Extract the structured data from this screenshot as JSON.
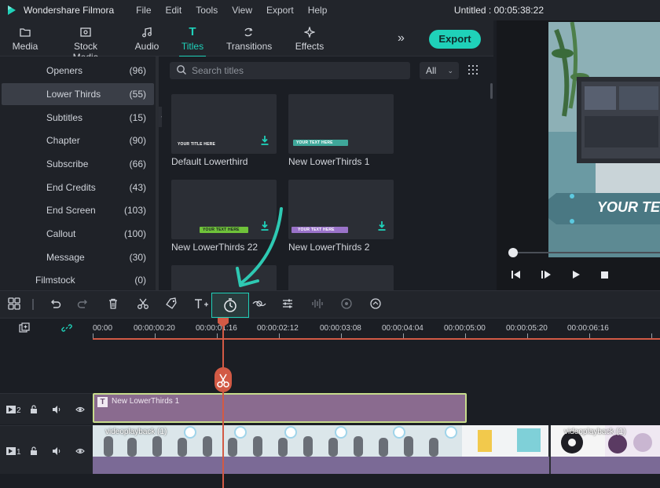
{
  "app": {
    "title": "Wondershare Filmora",
    "project_title": "Untitled : 00:05:38:22"
  },
  "menu": [
    "File",
    "Edit",
    "Tools",
    "View",
    "Export",
    "Help"
  ],
  "tabs": [
    {
      "label": "Media",
      "icon": "folder-icon"
    },
    {
      "label": "Stock Media",
      "icon": "stock-media-icon"
    },
    {
      "label": "Audio",
      "icon": "music-note-icon"
    },
    {
      "label": "Titles",
      "icon": "text-t-icon",
      "active": true
    },
    {
      "label": "Transitions",
      "icon": "transitions-icon"
    },
    {
      "label": "Effects",
      "icon": "effects-sparkle-icon"
    }
  ],
  "toolbar_top": {
    "more_label": "»",
    "export_label": "Export"
  },
  "categories": [
    {
      "name": "Openers",
      "count": "(96)"
    },
    {
      "name": "Lower Thirds",
      "count": "(55)",
      "selected": true
    },
    {
      "name": "Subtitles",
      "count": "(15)"
    },
    {
      "name": "Chapter",
      "count": "(90)"
    },
    {
      "name": "Subscribe",
      "count": "(66)"
    },
    {
      "name": "End Credits",
      "count": "(43)"
    },
    {
      "name": "End Screen",
      "count": "(103)"
    },
    {
      "name": "Callout",
      "count": "(100)"
    },
    {
      "name": "Message",
      "count": "(30)"
    },
    {
      "name": "Filmstock",
      "count": "(0)"
    }
  ],
  "search": {
    "placeholder": "Search titles"
  },
  "filter": {
    "value": "All"
  },
  "cards": [
    {
      "caption": "Default Lowerthird",
      "thumb_text": "YOUR TITLE HERE",
      "bar_color": ""
    },
    {
      "caption": "New LowerThirds 1",
      "thumb_text": "YOUR TEXT HERE",
      "bar_color": "#3fa79a"
    },
    {
      "caption": "New LowerThirds 22",
      "thumb_text": "YOUR TEXT HERE",
      "bar_color": "#6fc23a"
    },
    {
      "caption": "New LowerThirds 2",
      "thumb_text": "YOUR TEXT HERE",
      "bar_color": "#9a73c9"
    }
  ],
  "preview": {
    "overlay_text": "YOUR TE"
  },
  "timeline": {
    "ruler_labels": [
      "00:00",
      "00:00:00:20",
      "00:00:01:16",
      "00:00:02:12",
      "00:00:03:08",
      "00:00:04:04",
      "00:00:05:00",
      "00:00:05:20",
      "00:00:06:16"
    ],
    "tracks": [
      {
        "number": "2"
      },
      {
        "number": "1"
      }
    ],
    "title_clip": "New LowerThirds 1",
    "video_clip_1": "videoplayback (1)",
    "video_clip_2": "videoplayback (1)"
  },
  "colors": {
    "accent": "#1fd1b9",
    "playhead": "#d25a45",
    "title_clip": "#8a6b8f",
    "video_clip": "#7b6a96"
  }
}
